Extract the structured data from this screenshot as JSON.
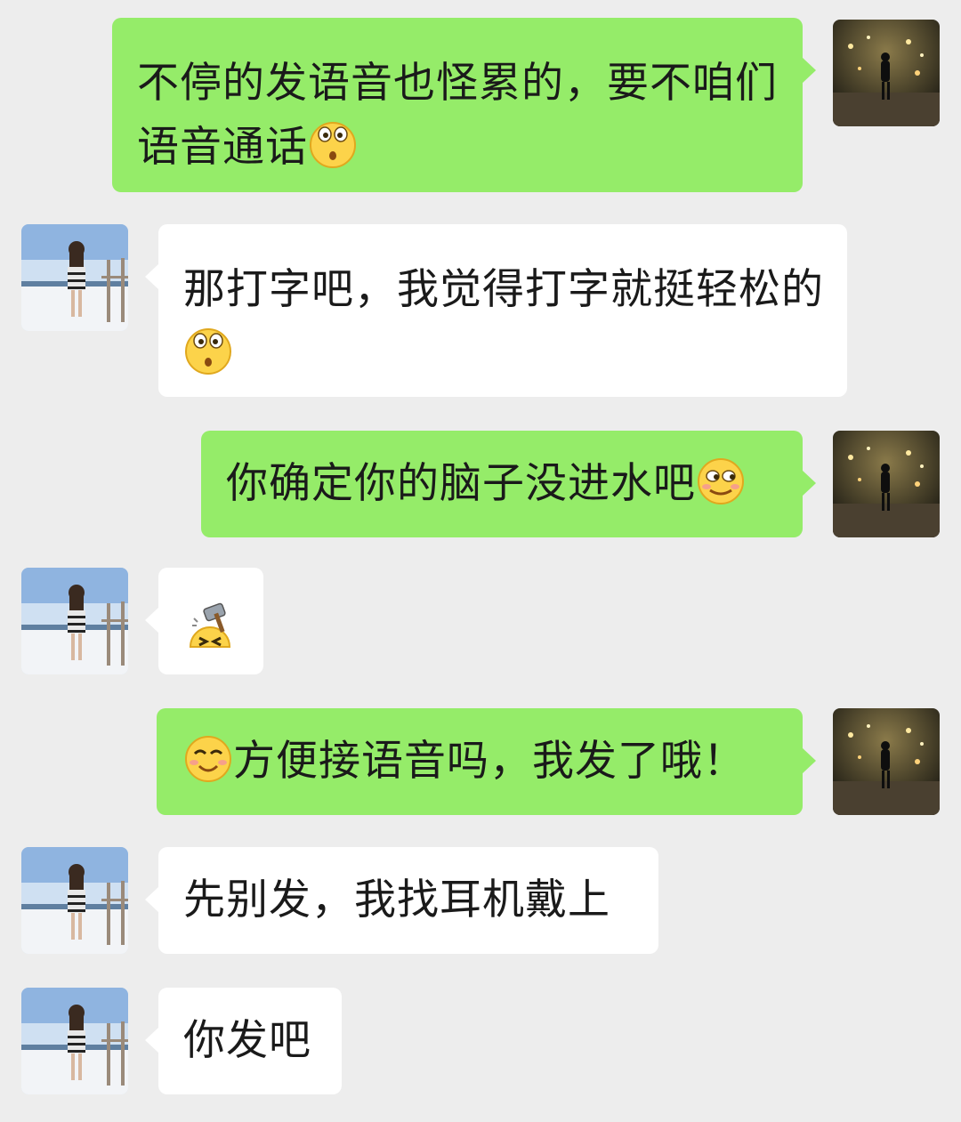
{
  "conversation": {
    "messages": [
      {
        "sender": "me",
        "text": "不停的发语音也怪累的，要不咱们语音通话",
        "emoji": "surprised-eyes-emoji"
      },
      {
        "sender": "other",
        "text": "那打字吧，我觉得打字就挺轻松的",
        "emoji": "surprised-eyes-emoji"
      },
      {
        "sender": "me",
        "text": "你确定你的脑子没进水吧",
        "emoji": "smirk-emoji"
      },
      {
        "sender": "other",
        "text": "",
        "emoji": "hammer-knock-emoji"
      },
      {
        "sender": "me",
        "text": "方便接语音吗，我发了哦！",
        "emoji": "blush-emoji",
        "emoji_position": "before"
      },
      {
        "sender": "other",
        "text": "先别发，我找耳机戴上"
      },
      {
        "sender": "other",
        "text": "你发吧"
      }
    ]
  },
  "colors": {
    "background": "#ededed",
    "my_bubble": "#95ec69",
    "their_bubble": "#ffffff"
  },
  "icons": {
    "my_avatar": "night-street-figure-avatar",
    "their_avatar": "snowy-pier-girl-avatar"
  }
}
